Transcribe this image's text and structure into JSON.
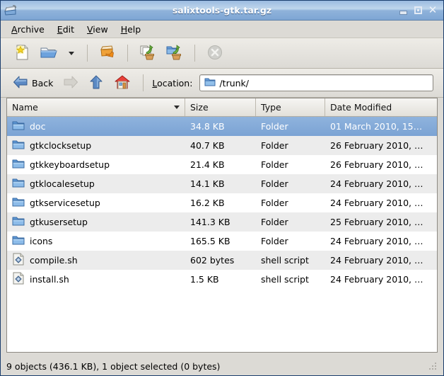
{
  "window": {
    "title": "salixtools-gtk.tar.gz",
    "icon": "archive-manager-icon",
    "controls": {
      "minimize": "minimize-button",
      "maximize": "maximize-button",
      "close": "close-button"
    }
  },
  "menubar": {
    "items": [
      {
        "label": "Archive",
        "mnemonic": "A"
      },
      {
        "label": "Edit",
        "mnemonic": "E"
      },
      {
        "label": "View",
        "mnemonic": "V"
      },
      {
        "label": "Help",
        "mnemonic": "H"
      }
    ]
  },
  "toolbar": {
    "buttons": [
      {
        "name": "new-archive-button",
        "icon": "new-document-star-icon",
        "enabled": true
      },
      {
        "name": "open-archive-button",
        "icon": "open-folder-icon",
        "enabled": true
      },
      {
        "name": "open-archive-dropdown",
        "icon": "chevron-down-icon",
        "enabled": true
      },
      {
        "name": "extract-button",
        "icon": "extract-archive-icon",
        "enabled": true
      },
      {
        "name": "add-files-button",
        "icon": "add-files-icon",
        "enabled": true
      },
      {
        "name": "add-folder-button",
        "icon": "add-folder-icon",
        "enabled": true
      },
      {
        "name": "stop-button",
        "icon": "stop-icon",
        "enabled": false
      }
    ]
  },
  "locationbar": {
    "back_label": "Back",
    "back_enabled": true,
    "forward_enabled": false,
    "up_enabled": true,
    "home_enabled": true,
    "location_label": "Location:",
    "location_mnemonic": "L",
    "location_value": "/trunk/",
    "location_placeholder": ""
  },
  "filelist": {
    "columns": [
      {
        "key": "name",
        "label": "Name",
        "sorted": true,
        "sort_dir": "descending"
      },
      {
        "key": "size",
        "label": "Size",
        "sorted": false
      },
      {
        "key": "type",
        "label": "Type",
        "sorted": false
      },
      {
        "key": "date",
        "label": "Date Modified",
        "sorted": false
      }
    ],
    "rows": [
      {
        "icon": "folder-icon",
        "name": "doc",
        "size": "34.8 KB",
        "type": "Folder",
        "date": "01 March 2010, 15…",
        "selected": true
      },
      {
        "icon": "folder-icon",
        "name": "gtkclocksetup",
        "size": "40.7 KB",
        "type": "Folder",
        "date": "26 February 2010, …",
        "selected": false
      },
      {
        "icon": "folder-icon",
        "name": "gtkkeyboardsetup",
        "size": "21.4 KB",
        "type": "Folder",
        "date": "26 February 2010, …",
        "selected": false
      },
      {
        "icon": "folder-icon",
        "name": "gtklocalesetup",
        "size": "14.1 KB",
        "type": "Folder",
        "date": "24 February 2010, …",
        "selected": false
      },
      {
        "icon": "folder-icon",
        "name": "gtkservicesetup",
        "size": "16.2 KB",
        "type": "Folder",
        "date": "24 February 2010, …",
        "selected": false
      },
      {
        "icon": "folder-icon",
        "name": "gtkusersetup",
        "size": "141.3 KB",
        "type": "Folder",
        "date": "25 February 2010, …",
        "selected": false
      },
      {
        "icon": "folder-icon",
        "name": "icons",
        "size": "165.5 KB",
        "type": "Folder",
        "date": "24 February 2010, …",
        "selected": false
      },
      {
        "icon": "shell-script-icon",
        "name": "compile.sh",
        "size": "602 bytes",
        "type": "shell script",
        "date": "24 February 2010, …",
        "selected": false
      },
      {
        "icon": "shell-script-icon",
        "name": "install.sh",
        "size": "1.5 KB",
        "type": "shell script",
        "date": "24 February 2010, …",
        "selected": false
      }
    ]
  },
  "statusbar": {
    "text": "9 objects (436.1 KB), 1 object selected (0 bytes)"
  },
  "colors": {
    "titlebar_gradient_top": "#9bbbe0",
    "titlebar_gradient_bottom": "#7ea6d4",
    "selection": "#7ba3d4",
    "chrome": "#dcdad5",
    "row_alt": "#ececec",
    "folder_blue": "#5a8fd0"
  }
}
